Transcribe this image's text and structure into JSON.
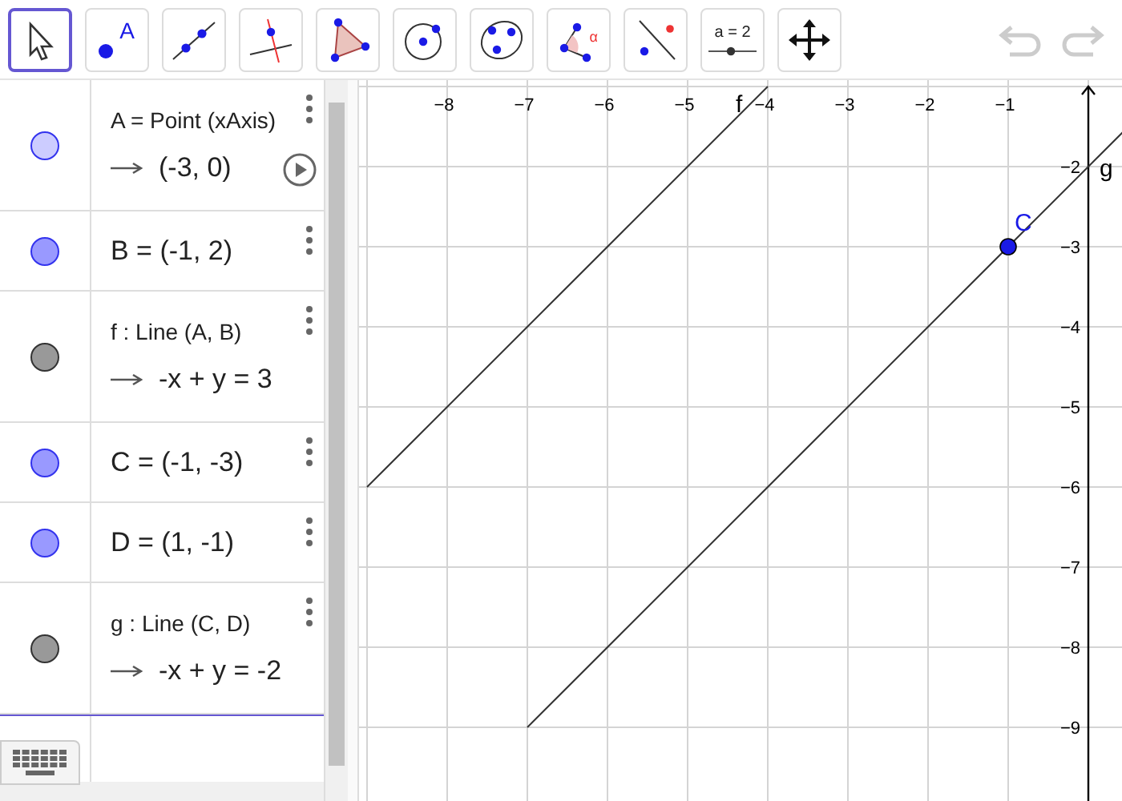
{
  "toolbar": {
    "tools": [
      {
        "kind": "move",
        "selected": true
      },
      {
        "kind": "point",
        "selected": false,
        "label": "A"
      },
      {
        "kind": "line",
        "selected": false
      },
      {
        "kind": "perpendicular",
        "selected": false
      },
      {
        "kind": "polygon",
        "selected": false
      },
      {
        "kind": "circle",
        "selected": false
      },
      {
        "kind": "conic",
        "selected": false
      },
      {
        "kind": "angle",
        "selected": false,
        "label": "α"
      },
      {
        "kind": "reflect",
        "selected": false
      },
      {
        "kind": "slider",
        "selected": false,
        "label": "a = 2"
      },
      {
        "kind": "move-view",
        "selected": false
      }
    ],
    "undo_disabled": true,
    "redo_disabled": true
  },
  "algebra": {
    "rows": [
      {
        "kind": "point",
        "color": "#ccccff",
        "definition": "A = Point (xAxis)",
        "value": "(-3, 0)",
        "animating": false
      },
      {
        "kind": "point",
        "color": "#9999ff",
        "definition": "B = (-1, 2)"
      },
      {
        "kind": "line",
        "color": "#999999",
        "definition": "f : Line (A, B)",
        "value": "-x + y = 3"
      },
      {
        "kind": "point",
        "color": "#9999ff",
        "definition": "C = (-1, -3)"
      },
      {
        "kind": "point",
        "color": "#9999ff",
        "definition": "D = (1, -1)"
      },
      {
        "kind": "line",
        "color": "#999999",
        "definition": "g : Line (C, D)",
        "value": "-x + y = -2"
      }
    ]
  },
  "graphics": {
    "x_tick_labels": [
      "−8",
      "−7",
      "−6",
      "−5",
      "−4",
      "−3",
      "−2",
      "−1"
    ],
    "y_tick_labels": [
      "−2",
      "−3",
      "−4",
      "−5",
      "−6",
      "−7",
      "−8",
      "−9"
    ],
    "line_labels": [
      "f",
      "g"
    ],
    "point_label": "C"
  }
}
